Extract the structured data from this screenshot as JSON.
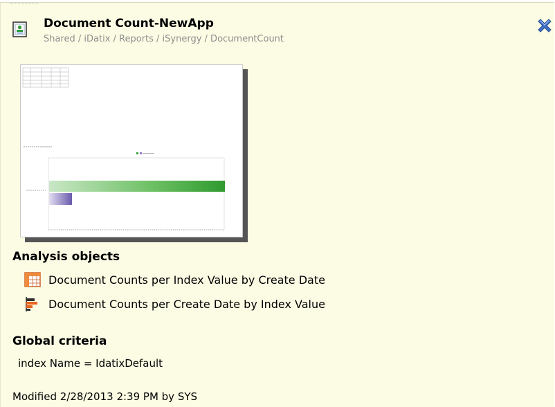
{
  "header": {
    "title": "Document Count-NewApp",
    "path": "Shared / iDatix / Reports / iSynergy / DocumentCount",
    "icon": "report-document-icon",
    "close_icon": "close-x-icon"
  },
  "thumbnail": {
    "icon": "report-preview-thumbnail"
  },
  "analysis": {
    "heading": "Analysis objects",
    "items": [
      {
        "label": "Document Counts per Index Value by Create Date",
        "icon": "cross-table-icon"
      },
      {
        "label": "Document Counts per Create Date by Index Value",
        "icon": "bar-chart-icon"
      }
    ]
  },
  "criteria": {
    "heading": "Global criteria",
    "text": "index Name = IdatixDefault"
  },
  "footer": {
    "modified": "Modified 2/28/2013 2:39 PM by SYS"
  },
  "colors": {
    "panel_bg": "#fcfce4",
    "close_blue": "#3f6fc4",
    "bar_green": "#3fa23f",
    "bar_purple": "#8a7bc4"
  }
}
